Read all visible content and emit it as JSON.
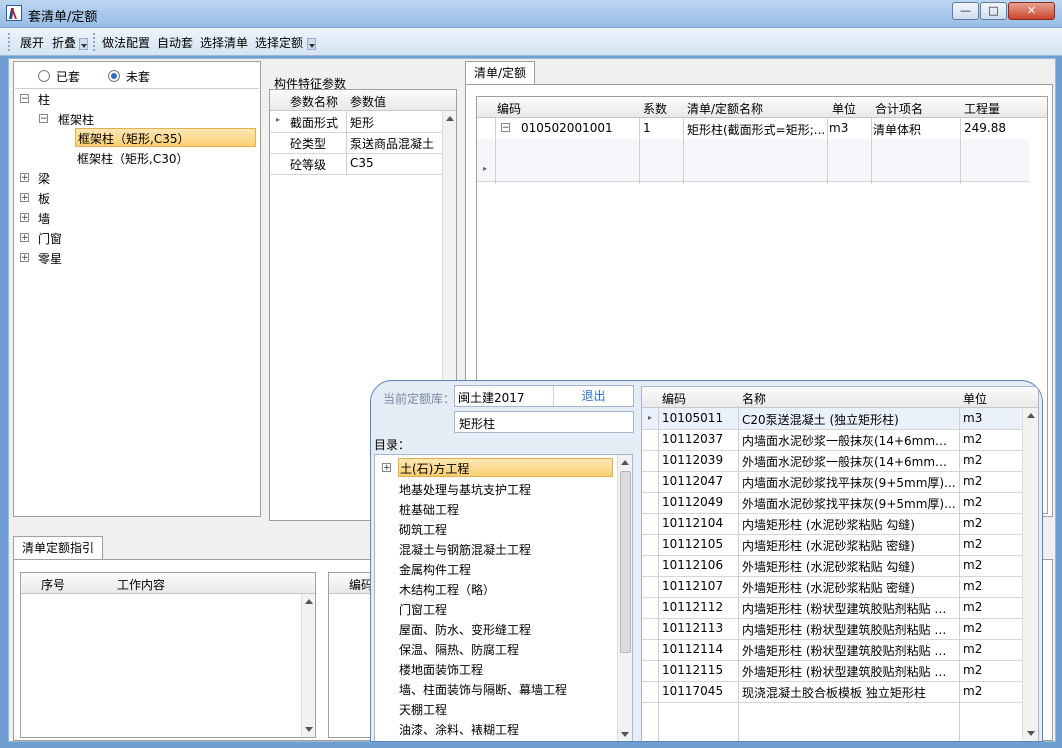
{
  "window": {
    "title": "套清单/定额",
    "minimize": "—",
    "maximize": "□",
    "close": "✕"
  },
  "toolbar": {
    "expand": "展开",
    "collapse": "折叠",
    "method_config": "做法配置",
    "auto_apply": "自动套",
    "select_list": "选择清单",
    "select_quota": "选择定额"
  },
  "filter": {
    "applied": "已套",
    "unapplied": "未套"
  },
  "tree": {
    "root": "柱",
    "child": "框架柱",
    "leaf1": "框架柱（矩形,C35）",
    "leaf2": "框架柱（矩形,C30）",
    "others": [
      "梁",
      "板",
      "墙",
      "门窗",
      "零星"
    ]
  },
  "params": {
    "title": "构件特征参数",
    "col_name": "参数名称",
    "col_value": "参数值",
    "rows": [
      {
        "name": "截面形式",
        "value": "矩形"
      },
      {
        "name": "砼类型",
        "value": "泵送商品混凝土"
      },
      {
        "name": "砼等级",
        "value": "C35"
      }
    ]
  },
  "list_tab": "清单/定额",
  "list": {
    "cols": [
      "编码",
      "系数",
      "清单/定额名称",
      "单位",
      "合计项名",
      "工程量"
    ],
    "row": {
      "code": "010502001001",
      "coef": "1",
      "name": "矩形柱(截面形式=矩形;...",
      "unit": "m3",
      "sum": "清单体积",
      "qty": "249.88"
    }
  },
  "guide": {
    "tab": "清单定额指引",
    "cols": [
      "序号",
      "工作内容"
    ],
    "right_col": "编码"
  },
  "quota": {
    "lib_label": "当前定额库：",
    "lib_value": "闽土建2017",
    "exit": "退出",
    "search": "矩形柱",
    "catalog_label": "目录：",
    "catalog": [
      "土(石)方工程",
      "地基处理与基坑支护工程",
      "桩基础工程",
      "砌筑工程",
      "混凝土与钢筋混凝土工程",
      "金属构件工程",
      "木结构工程（略）",
      "门窗工程",
      "屋面、防水、变形缝工程",
      "保温、隔热、防腐工程",
      "楼地面装饰工程",
      "墙、柱面装饰与隔断、幕墙工程",
      "天棚工程",
      "油漆、涂料、裱糊工程"
    ],
    "cols": [
      "编码",
      "名称",
      "单位"
    ],
    "rows": [
      {
        "code": "10105011",
        "name": "C20泵送混凝土 (独立矩形柱)",
        "unit": "m3"
      },
      {
        "code": "10112037",
        "name": "内墙面水泥砂浆一般抹灰(14+6mm厚...",
        "unit": "m2"
      },
      {
        "code": "10112039",
        "name": "外墙面水泥砂浆一般抹灰(14+6mm厚...",
        "unit": "m2"
      },
      {
        "code": "10112047",
        "name": "内墙面水泥砂浆找平抹灰(9+5mm厚)...",
        "unit": "m2"
      },
      {
        "code": "10112049",
        "name": "外墙面水泥砂浆找平抹灰(9+5mm厚)...",
        "unit": "m2"
      },
      {
        "code": "10112104",
        "name": "内墙矩形柱 (水泥砂浆粘贴 勾缝)",
        "unit": "m2"
      },
      {
        "code": "10112105",
        "name": "内墙矩形柱 (水泥砂浆粘贴 密缝)",
        "unit": "m2"
      },
      {
        "code": "10112106",
        "name": "外墙矩形柱 (水泥砂浆粘贴 勾缝)",
        "unit": "m2"
      },
      {
        "code": "10112107",
        "name": "外墙矩形柱 (水泥砂浆粘贴 密缝)",
        "unit": "m2"
      },
      {
        "code": "10112112",
        "name": "内墙矩形柱 (粉状型建筑胶贴剂粘贴 勾...",
        "unit": "m2"
      },
      {
        "code": "10112113",
        "name": "内墙矩形柱 (粉状型建筑胶贴剂粘贴 密...",
        "unit": "m2"
      },
      {
        "code": "10112114",
        "name": "外墙矩形柱 (粉状型建筑胶贴剂粘贴 勾...",
        "unit": "m2"
      },
      {
        "code": "10112115",
        "name": "外墙矩形柱 (粉状型建筑胶贴剂粘贴 密...",
        "unit": "m2"
      },
      {
        "code": "10117045",
        "name": "现浇混凝土胶合板模板 独立矩形柱",
        "unit": "m2"
      }
    ]
  }
}
